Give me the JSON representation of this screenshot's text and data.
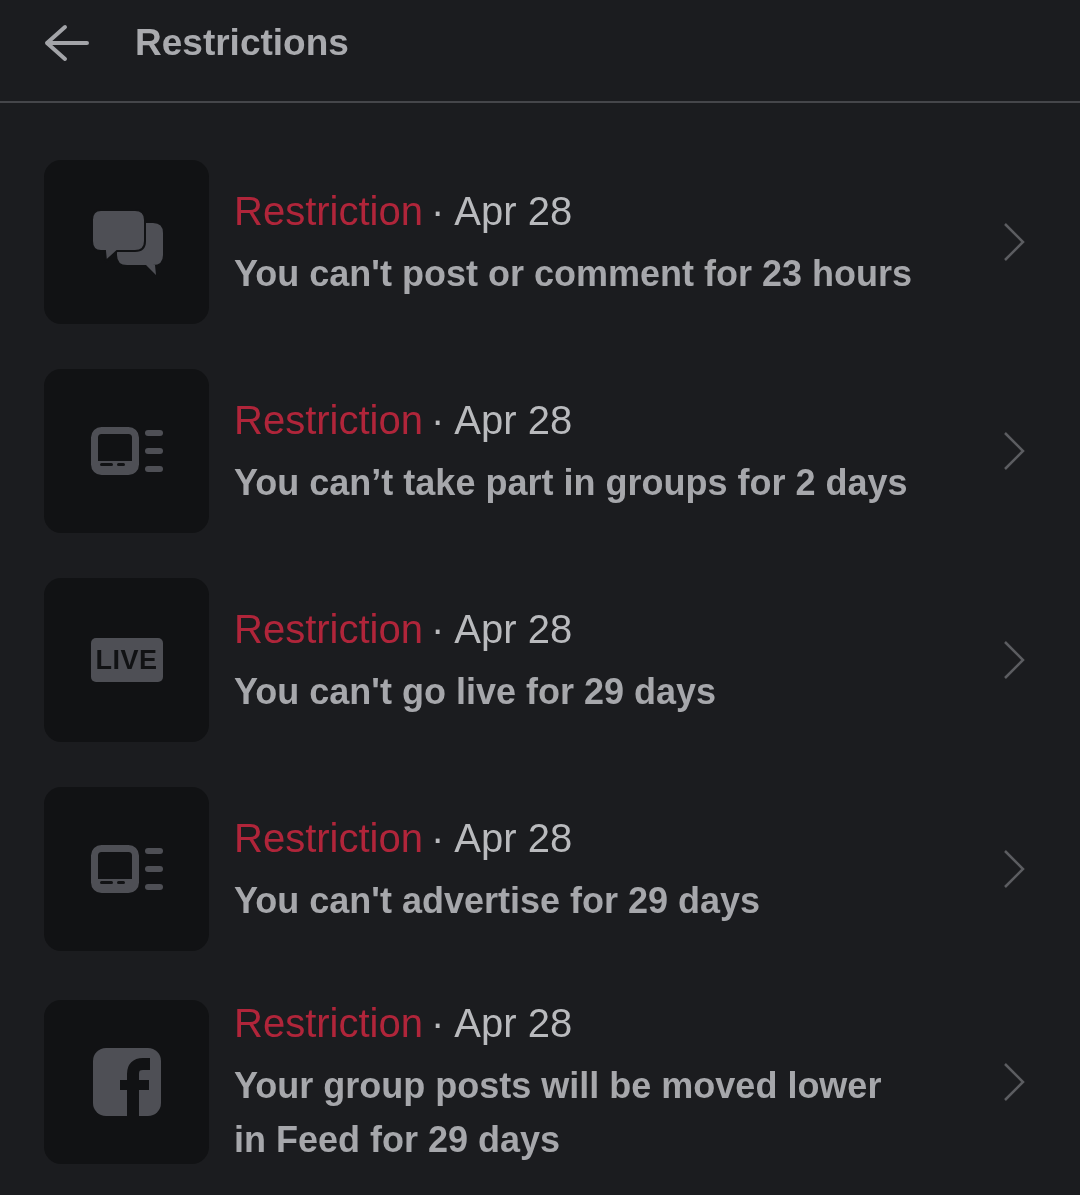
{
  "header": {
    "title": "Restrictions"
  },
  "restrictions": [
    {
      "kind": "chat",
      "label": "Restriction",
      "separator": "·",
      "date": "Apr 28",
      "description": "You can't post or comment for 23 hours"
    },
    {
      "kind": "panel",
      "label": "Restriction",
      "separator": "·",
      "date": "Apr 28",
      "description": "You can’t take part in groups for 2 days"
    },
    {
      "kind": "live",
      "badge_text": "LIVE",
      "label": "Restriction",
      "separator": "·",
      "date": "Apr 28",
      "description": "You can't go live for 29 days"
    },
    {
      "kind": "panel",
      "label": "Restriction",
      "separator": "·",
      "date": "Apr 28",
      "description": "You can't advertise for 29 days"
    },
    {
      "kind": "f-logo",
      "label": "Restriction",
      "separator": "·",
      "date": "Apr 28",
      "description": "Your group posts will be moved lower in Feed for 29 days"
    }
  ]
}
